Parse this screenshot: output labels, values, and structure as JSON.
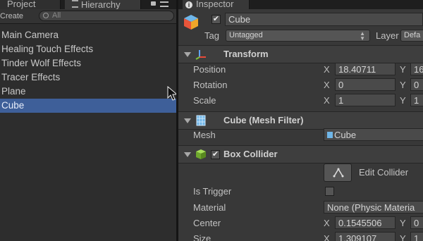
{
  "tabs": {
    "project": "Project",
    "hierarchy": "Hierarchy",
    "inspector": "Inspector"
  },
  "hierarchy": {
    "create_label": "Create",
    "search_placeholder": "All",
    "items": [
      "Main Camera",
      "Healing Touch Effects",
      "Tinder Wolf Effects",
      "Tracer Effects",
      "Plane",
      "Cube"
    ],
    "selected": "Cube"
  },
  "inspector": {
    "object_name": "Cube",
    "tag_label": "Tag",
    "tag_value": "Untagged",
    "layer_label": "Layer",
    "layer_value": "Defa",
    "transform": {
      "title": "Transform",
      "position_label": "Position",
      "position_x": "18.40711",
      "position_y": "16",
      "rotation_label": "Rotation",
      "rotation_x": "0",
      "rotation_y": "0",
      "scale_label": "Scale",
      "scale_x": "1",
      "scale_y": "1"
    },
    "mesh_filter": {
      "title": "Cube (Mesh Filter)",
      "mesh_label": "Mesh",
      "mesh_value": "Cube"
    },
    "box_collider": {
      "title": "Box Collider",
      "edit_label": "Edit Collider",
      "is_trigger_label": "Is Trigger",
      "material_label": "Material",
      "material_value": "None (Physic Materia",
      "center_label": "Center",
      "center_x": "0.1545506",
      "center_y": "0",
      "size_label": "Size",
      "size_x": "1.309107",
      "size_y": "1"
    },
    "axis_x": "X",
    "axis_y": "Y"
  }
}
